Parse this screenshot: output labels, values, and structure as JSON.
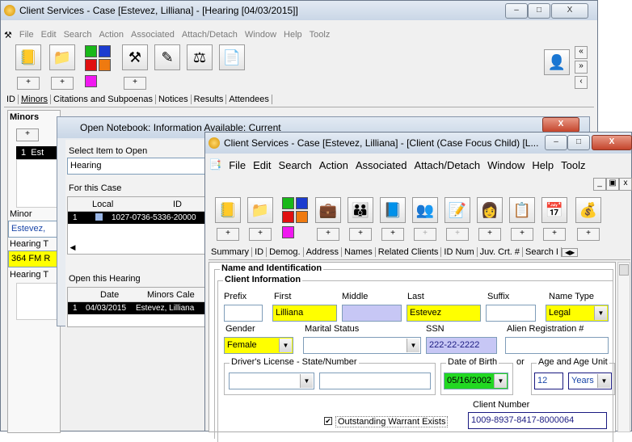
{
  "back": {
    "title": "Client Services - Case [Estevez, Lilliana] - [Hearing [04/03/2015]]",
    "menu": [
      "File",
      "Edit",
      "Search",
      "Action",
      "Associated",
      "Attach/Detach",
      "Window",
      "Help",
      "Toolz"
    ],
    "tabs": [
      "ID",
      "Minors",
      "Citations and Subpoenas",
      "Notices",
      "Results",
      "Attendees"
    ],
    "minors_label": "Minors",
    "row1": "1",
    "row1_name": "Est",
    "minor_label": "Minor",
    "minor_value": "Estevez,",
    "hearing_t_label": "Hearing T",
    "hearing_t_value": "364 FM R",
    "hearing_t2_label": "Hearing T",
    "plus": "+"
  },
  "notebook": {
    "title": "Open Notebook: Information Available: Current",
    "select_label": "Select Item to Open",
    "select_value": "Hearing",
    "for_case_label": "For this Case",
    "case_headers": [
      "Local",
      "ID"
    ],
    "case_row": {
      "num": "1",
      "id": "1027-0736-5336-20000"
    },
    "open_hearing_label": "Open this Hearing",
    "hearing_headers": [
      "Date",
      "Minors Cale"
    ],
    "hearing_row": {
      "num": "1",
      "date": "04/03/2015",
      "minor": "Estevez, Lilliana"
    }
  },
  "front": {
    "title": "Client Services - Case [Estevez, Lilliana] - [Client (Case Focus Child) [L...",
    "menu": [
      "File",
      "Edit",
      "Search",
      "Action",
      "Associated",
      "Attach/Detach",
      "Window",
      "Help",
      "Toolz"
    ],
    "tabs": [
      "Summary",
      "ID",
      "Demog.",
      "Address",
      "Names",
      "Related Clients",
      "ID Num",
      "Juv. Crt. #",
      "Search I"
    ],
    "section": "Name and Identification",
    "client_info": "Client Information",
    "labels": {
      "prefix": "Prefix",
      "first": "First",
      "middle": "Middle",
      "last": "Last",
      "suffix": "Suffix",
      "name_type": "Name Type",
      "gender": "Gender",
      "marital": "Marital Status",
      "ssn": "SSN",
      "alien": "Alien Registration #",
      "dl": "Driver's License - State/Number",
      "dob": "Date of Birth",
      "or": "or",
      "age": "Age and Age Unit",
      "client_number": "Client Number"
    },
    "values": {
      "prefix": "",
      "first": "Lilliana",
      "middle": "",
      "last": "Estevez",
      "suffix": "",
      "name_type": "Legal",
      "gender": "Female",
      "marital": "",
      "ssn": "222-22-2222",
      "alien": "",
      "dl_state": "",
      "dl_number": "",
      "dob": "05/16/2002",
      "age": "12",
      "age_unit": "Years",
      "client_number": "1009-8937-8417-8000064"
    },
    "warrant": "Outstanding Warrant Exists",
    "plus": "+"
  }
}
